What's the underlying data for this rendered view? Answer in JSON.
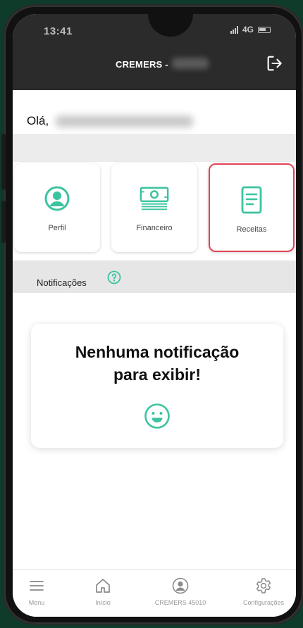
{
  "status_bar": {
    "time": "13:41",
    "network": "4G"
  },
  "header": {
    "title": "CREMERS -",
    "logout_icon": "logout-icon"
  },
  "greeting": {
    "prefix": "Olá,"
  },
  "cards": [
    {
      "label": "Perfil",
      "icon": "user-circle-icon"
    },
    {
      "label": "Financeiro",
      "icon": "money-icon"
    },
    {
      "label": "Receitas",
      "icon": "document-icon",
      "selected": true
    }
  ],
  "notifications": {
    "title": "Notificações",
    "empty_line1": "Nenhuma notificação",
    "empty_line2": "para exibir!",
    "icon": "smile-icon"
  },
  "bottom_nav": [
    {
      "label": "Menu",
      "icon": "menu-icon"
    },
    {
      "label": "Início",
      "icon": "home-icon"
    },
    {
      "label": "CREMERS 45010",
      "icon": "user-circle-icon"
    },
    {
      "label": "Configurações",
      "icon": "gear-icon"
    }
  ],
  "colors": {
    "accent": "#3cc3a0",
    "header_bg": "#2b2b2b",
    "selected_border": "#e24554",
    "background": "#0e3b2a"
  }
}
